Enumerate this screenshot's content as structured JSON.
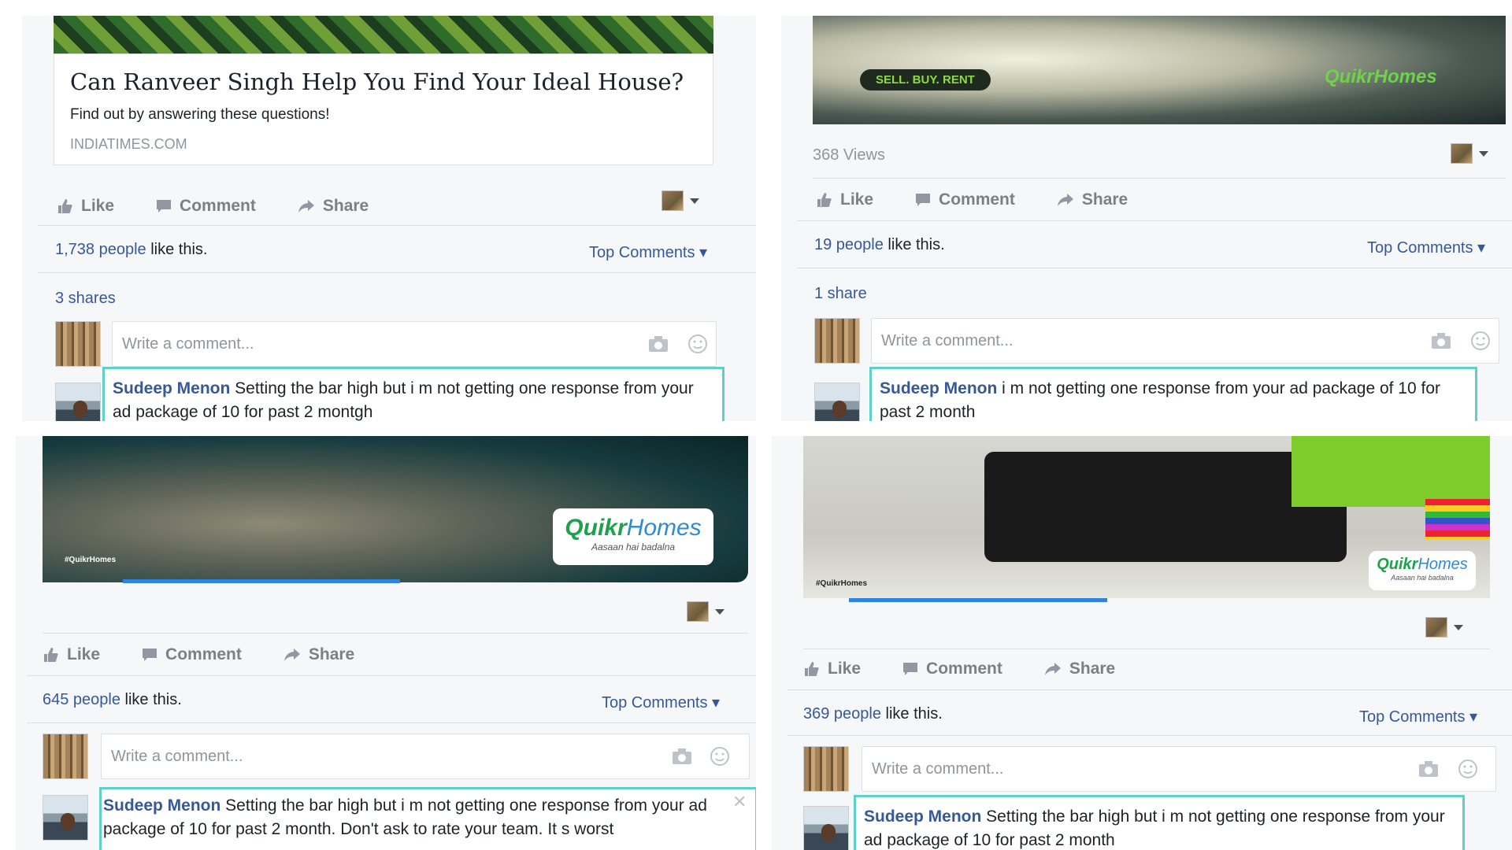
{
  "panels": [
    {
      "link": {
        "title": "Can Ranveer Singh Help You Find Your Ideal House?",
        "description": "Find out by answering these questions!",
        "domain": "INDIATIMES.COM"
      },
      "actions": {
        "like": "Like",
        "comment": "Comment",
        "share": "Share"
      },
      "likes_count": "1,738 people",
      "likes_suffix": " like this.",
      "top_comments": "Top Comments",
      "shares": "3 shares",
      "comment_placeholder": "Write a comment...",
      "reply_name": "Sudeep Menon",
      "reply_text": " Setting the bar high but i m not getting one response from your ad package of 10 for past 2 montgh"
    },
    {
      "video": {
        "tag": "SELL. BUY. RENT",
        "logo": "QuikrHomes"
      },
      "views": "368 Views",
      "actions": {
        "like": "Like",
        "comment": "Comment",
        "share": "Share"
      },
      "likes_count": "19 people",
      "likes_suffix": " like this.",
      "top_comments": "Top Comments",
      "shares": "1 share",
      "comment_placeholder": "Write a comment...",
      "reply_name": "Sudeep Menon",
      "reply_text": " i m not getting one response from your ad package of 10 for past 2 month"
    },
    {
      "video": {
        "hashtag": "#QuikrHomes",
        "logo_a": "Quikr",
        "logo_b": "Homes",
        "tagline": "Aasaan hai badalna"
      },
      "actions": {
        "like": "Like",
        "comment": "Comment",
        "share": "Share"
      },
      "likes_count": "645 people",
      "likes_suffix": " like this.",
      "top_comments": "Top Comments",
      "comment_placeholder": "Write a comment...",
      "reply_name": "Sudeep Menon",
      "reply_text": " Setting the bar high but i m not getting one response from your ad package of 10 for past 2 month. Don't ask to rate your team. It s worst"
    },
    {
      "video": {
        "hashtag": "#QuikrHomes",
        "logo_a": "Quikr",
        "logo_b": "Homes",
        "tagline": "Aasaan hai badalna"
      },
      "actions": {
        "like": "Like",
        "comment": "Comment",
        "share": "Share"
      },
      "likes_count": "369 people",
      "likes_suffix": " like this.",
      "top_comments": "Top Comments",
      "comment_placeholder": "Write a comment...",
      "reply_name": "Sudeep Menon",
      "reply_text": " Setting the bar high but i m not getting one response from your ad package of 10 for past 2 month"
    }
  ],
  "colors": {
    "link_blue": "#365899",
    "highlight_border": "#5fd0c8",
    "progress": "#2f82e0"
  },
  "icons": [
    "thumbs-up-icon",
    "comment-icon",
    "share-arrow-icon",
    "camera-icon",
    "emoji-icon",
    "caret-down-icon",
    "close-icon"
  ]
}
